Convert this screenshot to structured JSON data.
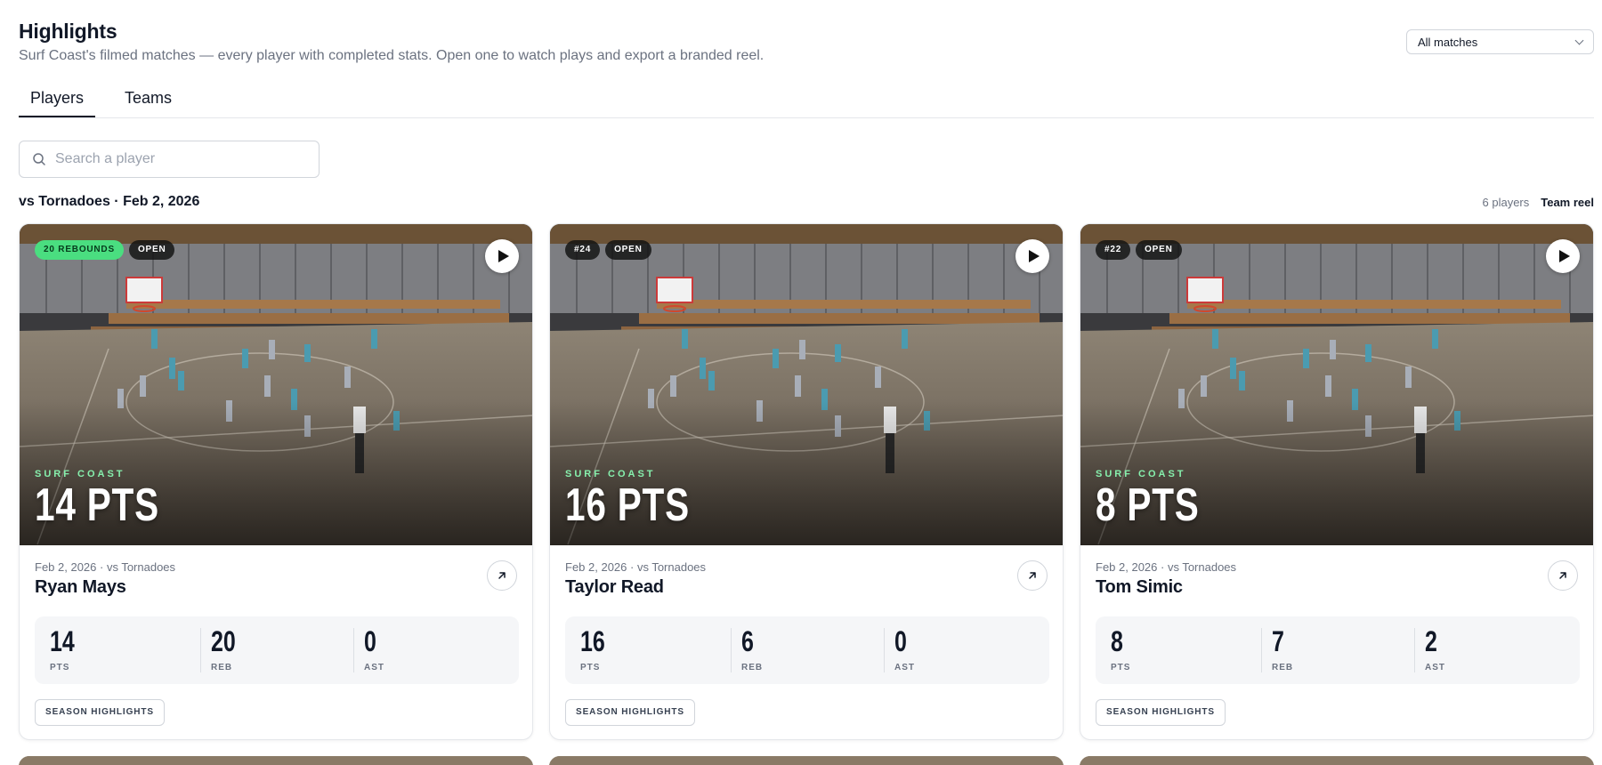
{
  "header": {
    "title": "Highlights",
    "subtitle": "Surf Coast's filmed matches — every player with completed stats. Open one to watch plays and export a branded reel."
  },
  "match_filter": {
    "selected": "All matches"
  },
  "tabs": [
    {
      "label": "Players",
      "active": true
    },
    {
      "label": "Teams",
      "active": false
    }
  ],
  "search": {
    "placeholder": "Search a player",
    "value": ""
  },
  "section": {
    "title": "vs Tornadoes · Feb 2, 2026",
    "player_count": "6 players",
    "team_reel_label": "Team reel"
  },
  "cards": [
    {
      "badges": [
        "20 REBOUNDS",
        "OPEN"
      ],
      "team": "SURF COAST",
      "headline": "14 PTS",
      "meta": "Feb 2, 2026 · vs Tornadoes",
      "name": "Ryan Mays",
      "stats": [
        {
          "value": "14",
          "label": "PTS"
        },
        {
          "value": "20",
          "label": "REB"
        },
        {
          "value": "0",
          "label": "AST"
        }
      ],
      "button": "SEASON HIGHLIGHTS"
    },
    {
      "badges": [
        "#24",
        "OPEN"
      ],
      "team": "SURF COAST",
      "headline": "16 PTS",
      "meta": "Feb 2, 2026 · vs Tornadoes",
      "name": "Taylor Read",
      "stats": [
        {
          "value": "16",
          "label": "PTS"
        },
        {
          "value": "6",
          "label": "REB"
        },
        {
          "value": "0",
          "label": "AST"
        }
      ],
      "button": "SEASON HIGHLIGHTS"
    },
    {
      "badges": [
        "#22",
        "OPEN"
      ],
      "team": "SURF COAST",
      "headline": "8 PTS",
      "meta": "Feb 2, 2026 · vs Tornadoes",
      "name": "Tom Simic",
      "stats": [
        {
          "value": "8",
          "label": "PTS"
        },
        {
          "value": "7",
          "label": "REB"
        },
        {
          "value": "2",
          "label": "AST"
        }
      ],
      "button": "SEASON HIGHLIGHTS"
    }
  ],
  "colors": {
    "accent_green": "#4ade80",
    "team_tag": "#86efac",
    "text_primary": "#111827",
    "text_muted": "#6b7280"
  },
  "icons": [
    "search-icon",
    "chevron-down-icon",
    "play-icon",
    "arrow-up-right-icon"
  ]
}
